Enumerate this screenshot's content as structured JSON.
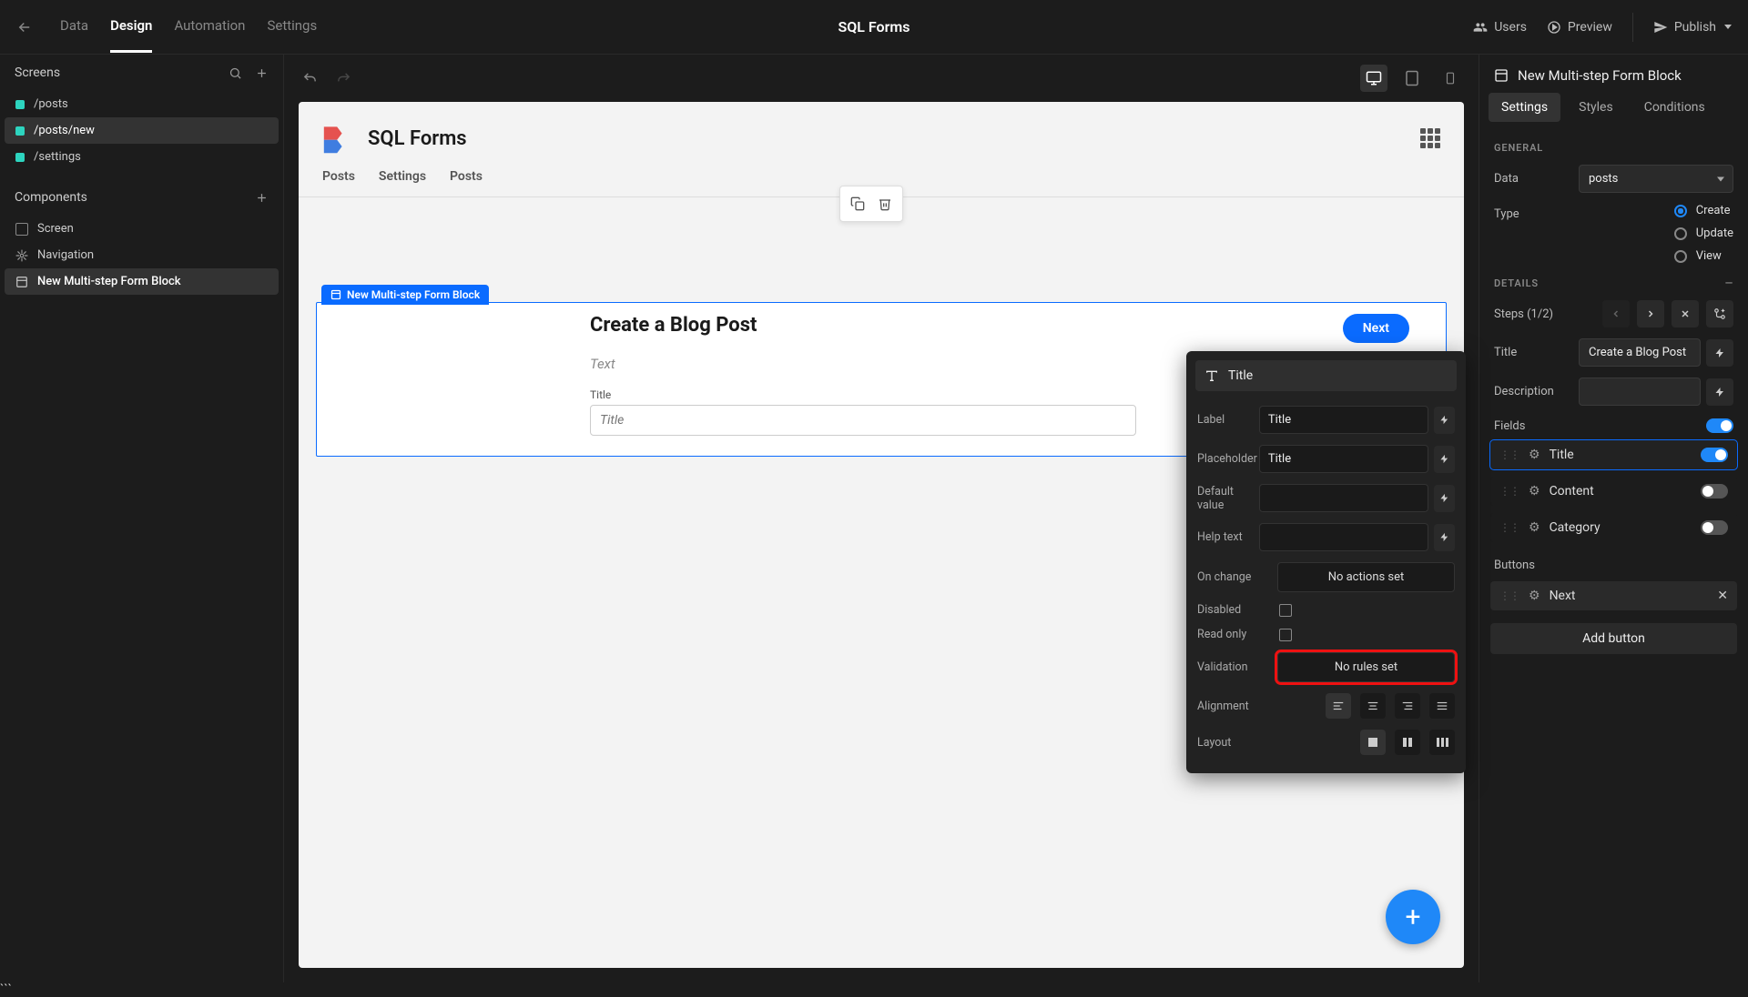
{
  "app_title": "SQL Forms",
  "top_nav": {
    "data": "Data",
    "design": "Design",
    "automation": "Automation",
    "settings": "Settings"
  },
  "top_right": {
    "users": "Users",
    "preview": "Preview",
    "publish": "Publish"
  },
  "left": {
    "screens_header": "Screens",
    "screens": [
      "/posts",
      "/posts/new",
      "/settings"
    ],
    "components_header": "Components",
    "components": [
      {
        "label": "Screen"
      },
      {
        "label": "Navigation"
      },
      {
        "label": "New Multi-step Form Block"
      }
    ]
  },
  "canvas": {
    "app_title": "SQL Forms",
    "tabs": [
      "Posts",
      "Settings",
      "Posts"
    ],
    "sel_chip": "New Multi-step Form Block",
    "form": {
      "heading": "Create a Blog Post",
      "next": "Next",
      "desc": "Text",
      "field_label": "Title",
      "field_placeholder": "Title"
    }
  },
  "right": {
    "title": "New Multi-step Form Block",
    "tabs": {
      "settings": "Settings",
      "styles": "Styles",
      "conditions": "Conditions"
    },
    "section_general": "GENERAL",
    "data_label": "Data",
    "data_value": "posts",
    "type_label": "Type",
    "type_options": {
      "create": "Create",
      "update": "Update",
      "view": "View"
    },
    "section_details": "DETAILS",
    "steps_label": "Steps (1/2)",
    "title_label": "Title",
    "title_value": "Create a Blog Post",
    "desc_label": "Description",
    "fields_label": "Fields",
    "fields": [
      {
        "label": "Title",
        "on": true,
        "selected": true
      },
      {
        "label": "Content",
        "on": false
      },
      {
        "label": "Category",
        "on": false
      }
    ],
    "buttons_label": "Buttons",
    "button_next": "Next",
    "add_button": "Add button"
  },
  "prop": {
    "title_value": "Title",
    "label_lbl": "Label",
    "label_val": "Title",
    "placeholder_lbl": "Placeholder",
    "placeholder_val": "Title",
    "default_lbl": "Default value",
    "help_lbl": "Help text",
    "onchange_lbl": "On change",
    "onchange_val": "No actions set",
    "disabled_lbl": "Disabled",
    "readonly_lbl": "Read only",
    "validation_lbl": "Validation",
    "validation_val": "No rules set",
    "alignment_lbl": "Alignment",
    "layout_lbl": "Layout"
  }
}
